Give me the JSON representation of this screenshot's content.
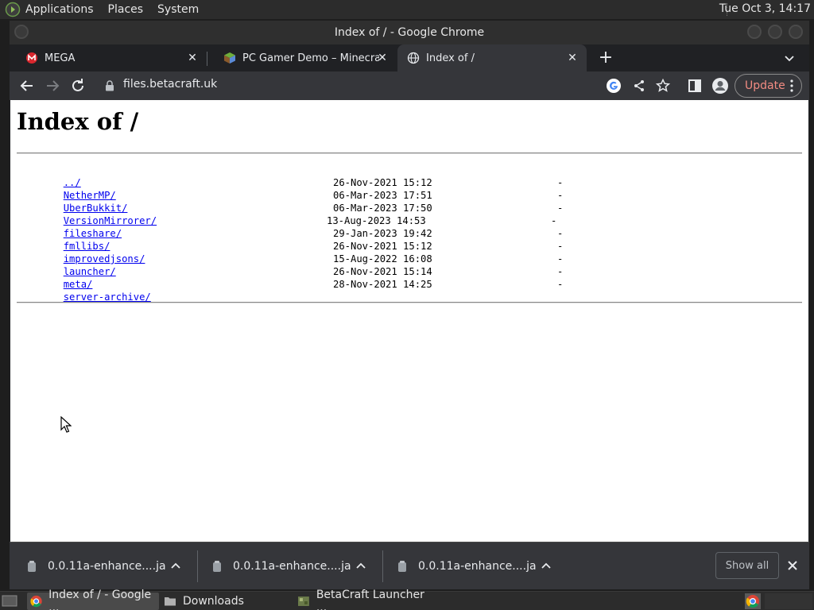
{
  "top_panel": {
    "menu": [
      "Applications",
      "Places",
      "System"
    ],
    "clock": "Tue Oct  3, 14:17"
  },
  "window": {
    "title": "Index of / - Google Chrome"
  },
  "tabs": [
    {
      "label": "MEGA",
      "favicon": "mega-icon"
    },
    {
      "label": "PC Gamer Demo – Minecraft W",
      "favicon": "minecraft-icon"
    },
    {
      "label": "Index of /",
      "favicon": "globe-icon",
      "active": true
    }
  ],
  "toolbar": {
    "url": "files.betacraft.uk",
    "update_label": "Update"
  },
  "page": {
    "heading": "Index of /",
    "parent_link": "../",
    "entries": [
      {
        "name": "NetherMP/",
        "date": "26-Nov-2021 15:12",
        "size": "-"
      },
      {
        "name": "UberBukkit/",
        "date": "06-Mar-2023 17:51",
        "size": "-"
      },
      {
        "name": "VersionMirrorer/",
        "date": "06-Mar-2023 17:50",
        "size": "-"
      },
      {
        "name": "fileshare/",
        "date": "13-Aug-2023 14:53",
        "size": "-"
      },
      {
        "name": "fmllibs/",
        "date": "29-Jan-2023 19:42",
        "size": "-"
      },
      {
        "name": "improvedjsons/",
        "date": "26-Nov-2021 15:12",
        "size": "-"
      },
      {
        "name": "launcher/",
        "date": "15-Aug-2022 16:08",
        "size": "-"
      },
      {
        "name": "meta/",
        "date": "26-Nov-2021 15:14",
        "size": "-"
      },
      {
        "name": "server-archive/",
        "date": "28-Nov-2021 14:25",
        "size": "-"
      }
    ]
  },
  "downloads": {
    "items": [
      "0.0.11a-enhance....jar",
      "0.0.11a-enhance....jar",
      "0.0.11a-enhance....jar"
    ],
    "show_all_label": "Show all"
  },
  "taskbar": {
    "tasks": [
      {
        "label": "Index of / - Google ...",
        "icon": "chrome-icon",
        "active": true
      },
      {
        "label": "Downloads",
        "icon": "folder-icon"
      },
      {
        "label": "BetaCraft Launcher ...",
        "icon": "betacraft-icon"
      }
    ]
  },
  "colors": {
    "link": "#0000ee",
    "update_text": "#f28b82",
    "chrome_dark": "#35363a"
  }
}
